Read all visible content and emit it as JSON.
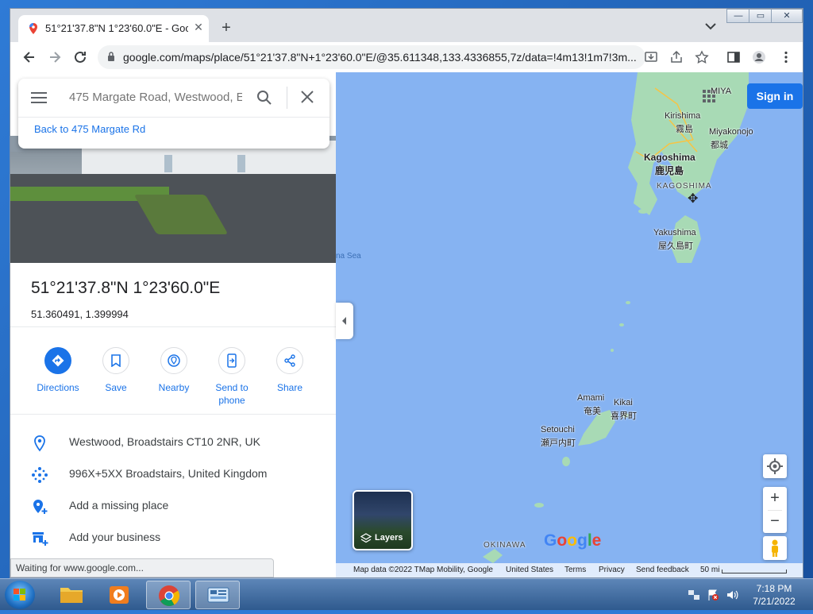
{
  "browser": {
    "tab_title": "51°21'37.8\"N 1°23'60.0\"E - Goog",
    "tab_close": "✕",
    "new_tab": "+",
    "url": "google.com/maps/place/51°21'37.8\"N+1°23'60.0\"E/@35.611348,133.4336855,7z/data=!4m13!1m7!3m...",
    "window_controls": [
      "—",
      "▭",
      "✕"
    ]
  },
  "search": {
    "placeholder": "475 Margate Road, Westwood, E",
    "back_link": "Back to 475 Margate Rd"
  },
  "place": {
    "title": "51°21'37.8\"N 1°23'60.0\"E",
    "decimal": "51.360491, 1.399994"
  },
  "actions": [
    {
      "label": "Directions"
    },
    {
      "label": "Save"
    },
    {
      "label": "Nearby"
    },
    {
      "label": "Send to phone"
    },
    {
      "label": "Share"
    }
  ],
  "info": [
    {
      "text": "Westwood, Broadstairs CT10 2NR, UK",
      "icon": "location-pin-icon"
    },
    {
      "text": "996X+5XX Broadstairs, United Kingdom",
      "icon": "plus-code-icon"
    },
    {
      "text": "Add a missing place",
      "icon": "add-place-icon"
    },
    {
      "text": "Add your business",
      "icon": "add-business-icon"
    }
  ],
  "status_text": "Waiting for www.google.com...",
  "map": {
    "sign_in": "Sign in",
    "layers": "Layers",
    "logo": "Google",
    "labels": {
      "miya": "MIYA",
      "kirishima": "Kirishima",
      "kirishima_jp": "霧島",
      "miyakonojo": "Miyakonojo",
      "miyakonojo_jp": "都城",
      "kagoshima": "Kagoshima",
      "kagoshima_jp": "鹿児島",
      "kagoshima_pref": "KAGOSHIMA",
      "yakushima": "Yakushima",
      "yakushima_jp": "屋久島町",
      "sea": "na Sea",
      "amami": "Amami",
      "amami_jp": "奄美",
      "kikai": "Kikai",
      "kikai_jp": "喜界町",
      "setouchi": "Setouchi",
      "setouchi_jp": "瀬戸内町",
      "okinawa": "OKINAWA"
    },
    "attribution": {
      "data": "Map data ©2022 TMap Mobility, Google",
      "region": "United States",
      "terms": "Terms",
      "privacy": "Privacy",
      "feedback": "Send feedback",
      "scale": "50 mi"
    },
    "zoom_in": "+",
    "zoom_out": "−"
  },
  "taskbar": {
    "time": "7:18 PM",
    "date": "7/21/2022"
  },
  "colors": {
    "accent": "#1a73e8",
    "land": "#a8dab5",
    "water": "#86b3f2"
  }
}
